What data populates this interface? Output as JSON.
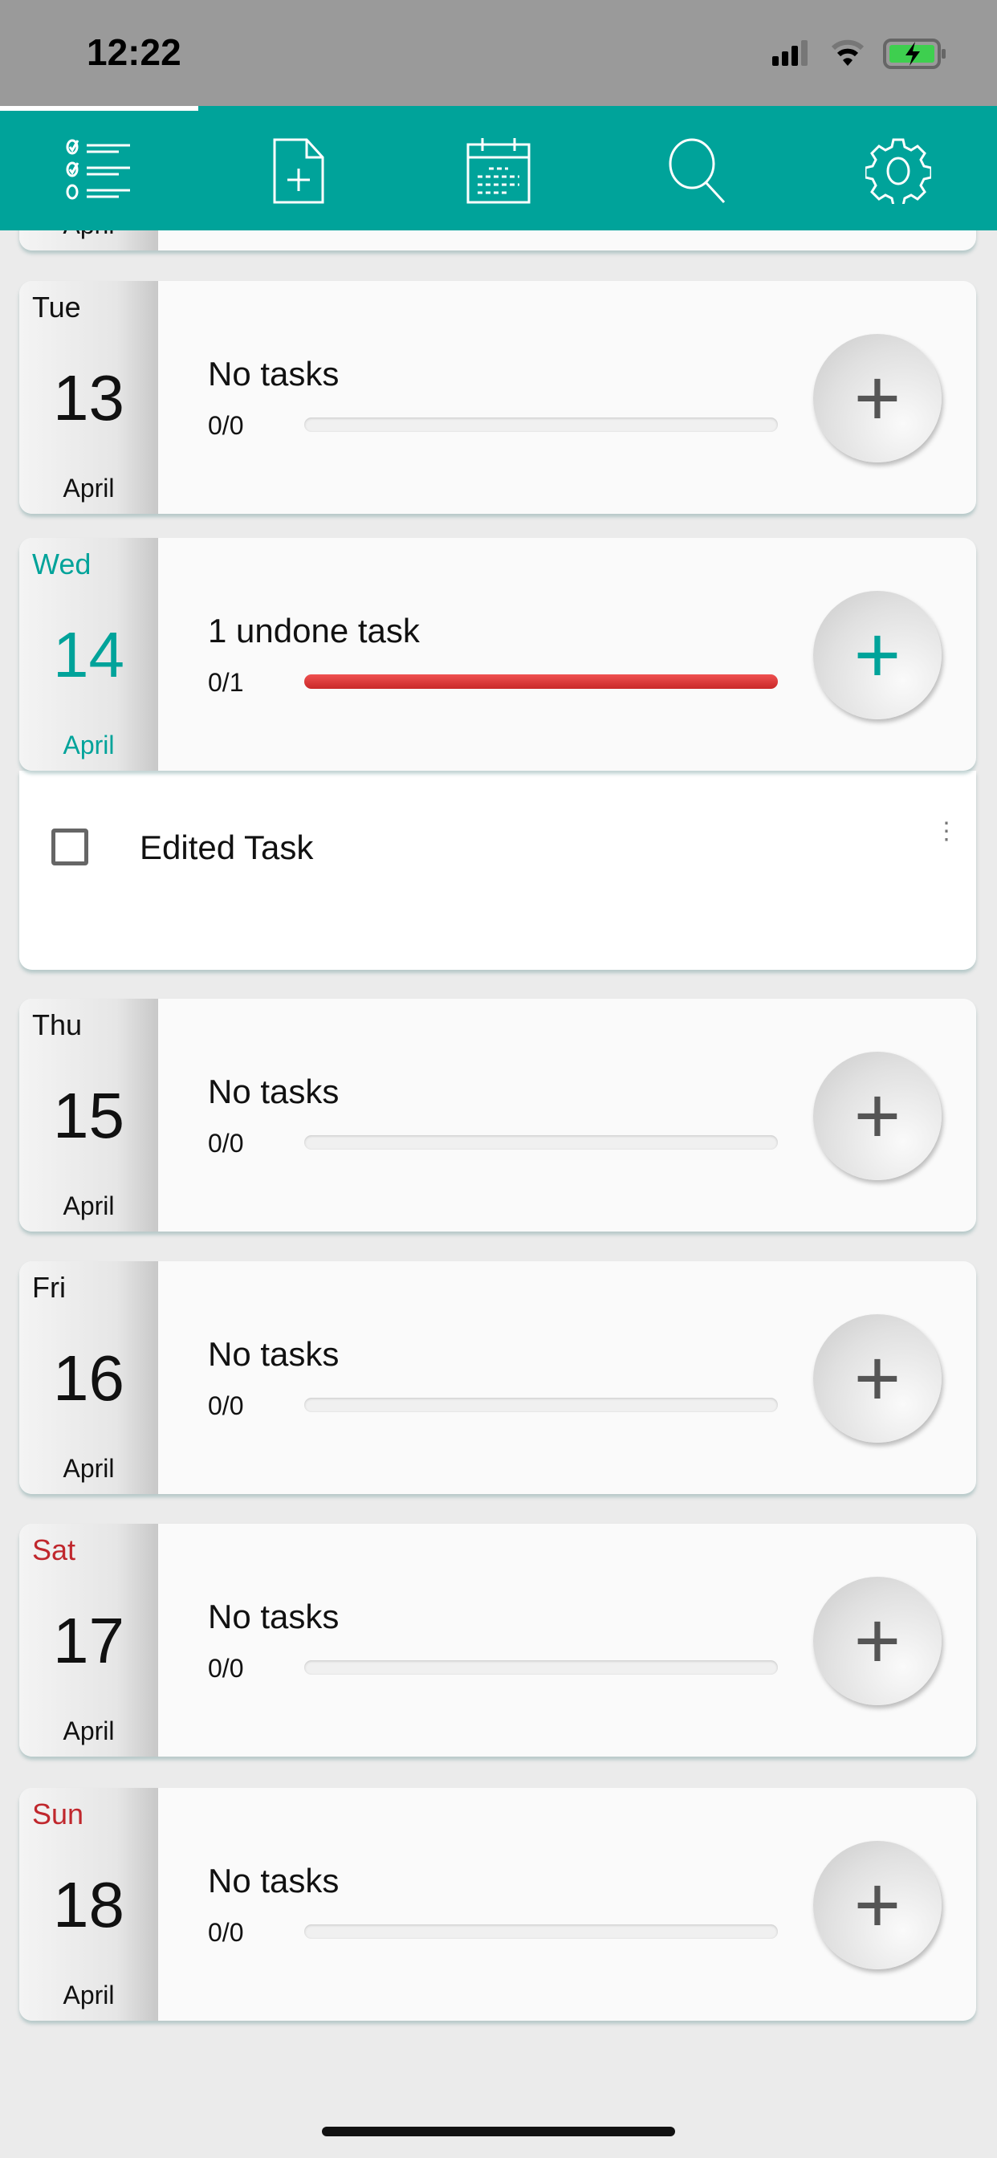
{
  "status_bar": {
    "time": "12:22"
  },
  "tabs": [
    {
      "name": "tasks-list"
    },
    {
      "name": "new-note"
    },
    {
      "name": "calendar"
    },
    {
      "name": "search"
    },
    {
      "name": "settings"
    }
  ],
  "partial_card": {
    "month": "April"
  },
  "days": [
    {
      "dow": "Tue",
      "day": "13",
      "month": "April",
      "title": "No tasks",
      "count": "0/0",
      "progress": 0,
      "color": "#111111",
      "plus_color": "#555555"
    },
    {
      "dow": "Wed",
      "day": "14",
      "month": "April",
      "title": "1 undone task",
      "count": "0/1",
      "progress": 1,
      "color": "#00a39a",
      "plus_color": "#00a39a",
      "bar_color": "#d93636"
    },
    {
      "dow": "Thu",
      "day": "15",
      "month": "April",
      "title": "No tasks",
      "count": "0/0",
      "progress": 0,
      "color": "#111111",
      "plus_color": "#555555"
    },
    {
      "dow": "Fri",
      "day": "16",
      "month": "April",
      "title": "No tasks",
      "count": "0/0",
      "progress": 0,
      "color": "#111111",
      "plus_color": "#555555"
    },
    {
      "dow": "Sat",
      "day": "17",
      "month": "April",
      "title": "No tasks",
      "count": "0/0",
      "progress": 0,
      "color": "#c0272d",
      "plus_color": "#555555"
    },
    {
      "dow": "Sun",
      "day": "18",
      "month": "April",
      "title": "No tasks",
      "count": "0/0",
      "progress": 0,
      "color": "#c0272d",
      "plus_color": "#555555"
    }
  ],
  "task": {
    "label": "Edited Task",
    "done": false
  },
  "plus_symbol": "+",
  "menu_symbol": "⋮"
}
